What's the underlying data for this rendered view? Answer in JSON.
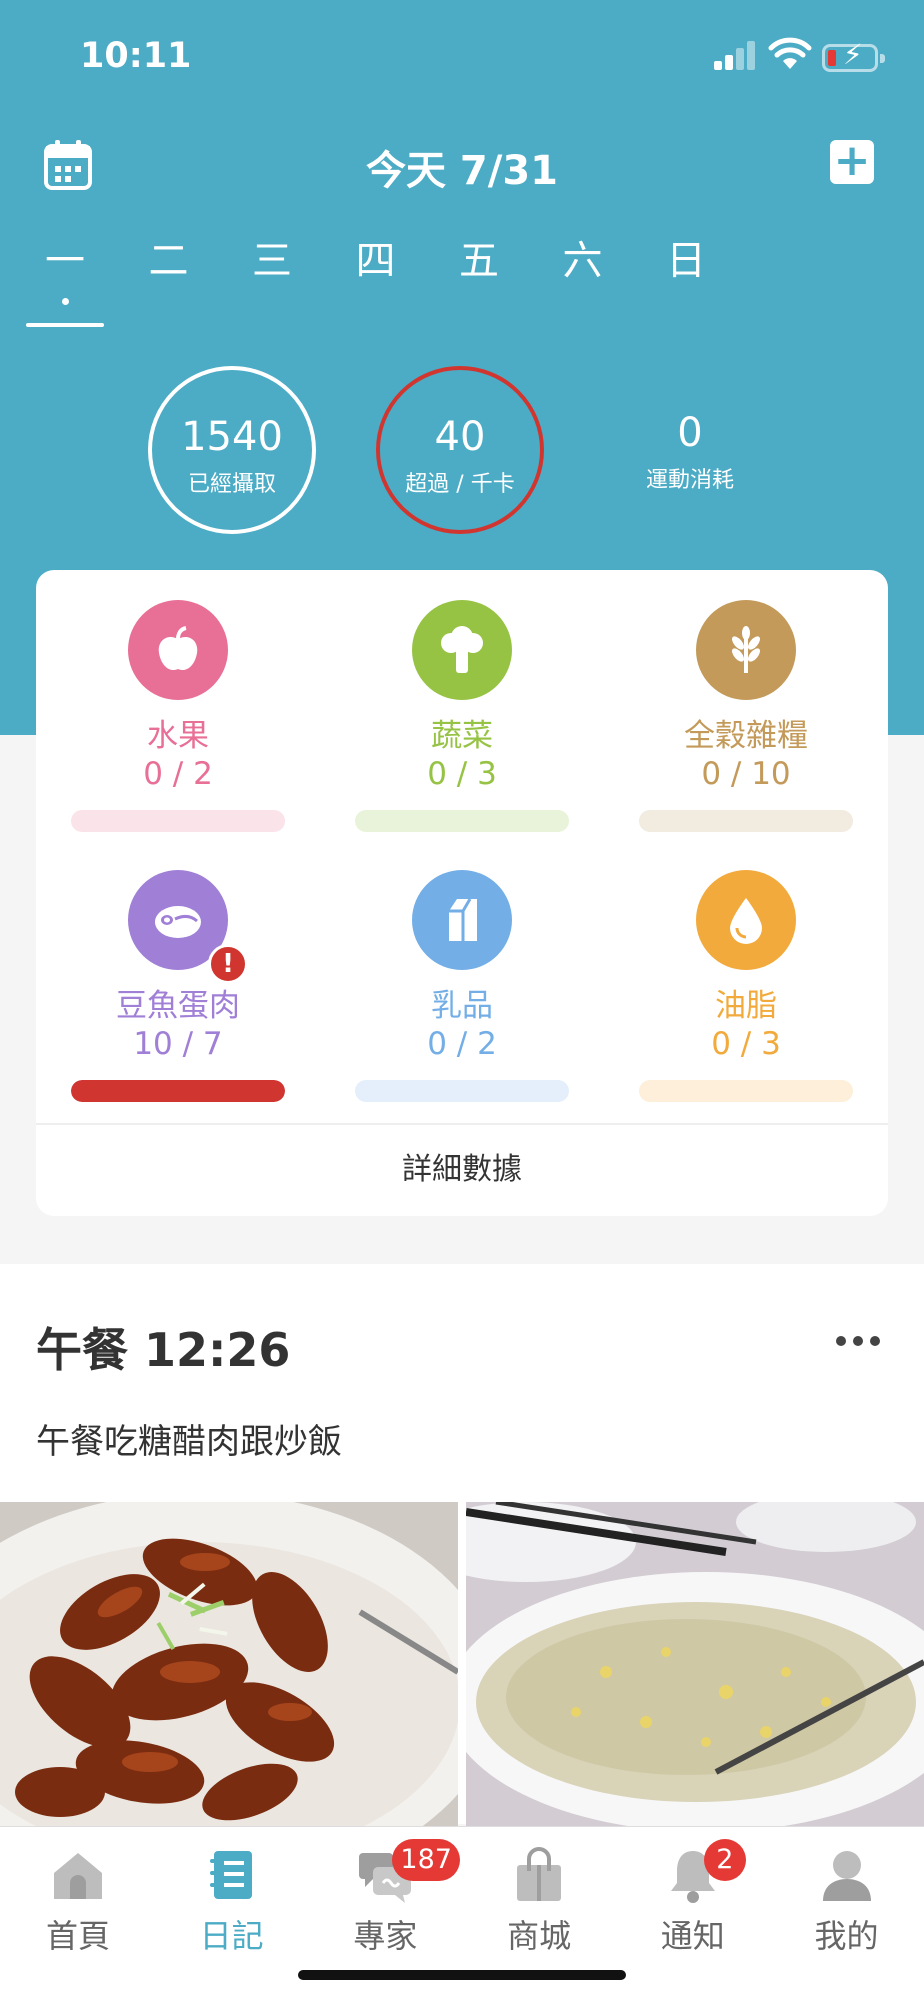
{
  "status_bar": {
    "time": "10:11"
  },
  "header": {
    "title": "今天 7/31"
  },
  "week": {
    "days": [
      "一",
      "二",
      "三",
      "四",
      "五",
      "六",
      "日"
    ],
    "selected_index": 0
  },
  "summary": [
    {
      "value": "1540",
      "label": "已經攝取",
      "ring": "white"
    },
    {
      "value": "40",
      "label": "超過 / 千卡",
      "ring": "red"
    },
    {
      "value": "0",
      "label": "運動消耗",
      "ring": "none"
    }
  ],
  "food_groups": [
    {
      "name": "水果",
      "value": "0 / 2",
      "progress": 0,
      "color": "#e86f95",
      "track": "#fbe3ea",
      "icon": "apple-icon"
    },
    {
      "name": "蔬菜",
      "value": "0 / 3",
      "progress": 0,
      "color": "#97c345",
      "track": "#e9f3d9",
      "icon": "broccoli-icon"
    },
    {
      "name": "全穀雜糧",
      "value": "0 / 10",
      "progress": 0,
      "color": "#c39a5a",
      "track": "#f2ebe0",
      "icon": "wheat-icon"
    },
    {
      "name": "豆魚蛋肉",
      "value": "10 / 7",
      "progress": 1,
      "color": "#a07fd6",
      "track": "#eee5f8",
      "fill_color": "#d0362f",
      "warning": "!",
      "icon": "meat-icon"
    },
    {
      "name": "乳品",
      "value": "0 / 2",
      "progress": 0,
      "color": "#73aee6",
      "track": "#e4effb",
      "icon": "milk-carton-icon"
    },
    {
      "name": "油脂",
      "value": "0 / 3",
      "progress": 0,
      "color": "#f2aa3c",
      "track": "#fdefd9",
      "icon": "oil-drop-icon"
    }
  ],
  "detail_link": "詳細數據",
  "meal": {
    "title": "午餐 12:26",
    "note": "午餐吃糖醋肉跟炒飯",
    "photos": [
      "sweet-sour-pork-photo",
      "fried-rice-photo"
    ]
  },
  "tabs": [
    {
      "label": "首頁",
      "icon": "home-icon"
    },
    {
      "label": "日記",
      "icon": "diary-icon",
      "active": true
    },
    {
      "label": "專家",
      "icon": "chat-icon",
      "badge": "187"
    },
    {
      "label": "商城",
      "icon": "shopping-bag-icon"
    },
    {
      "label": "通知",
      "icon": "bell-icon",
      "badge": "2"
    },
    {
      "label": "我的",
      "icon": "profile-icon"
    }
  ],
  "colors": {
    "primary": "#4cabc5",
    "alert": "#d0362f",
    "badge": "#e53935"
  }
}
